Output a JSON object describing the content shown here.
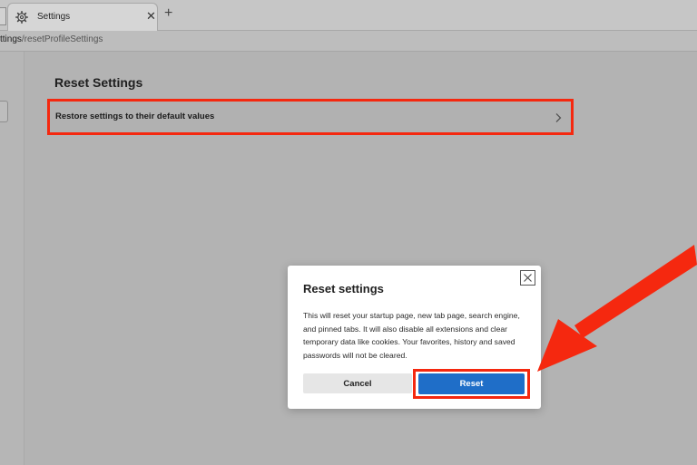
{
  "browser": {
    "tab": {
      "title": "Settings",
      "icon": "gear-icon",
      "close_icon": "close-icon"
    },
    "new_tab_icon": "plus-icon",
    "address": {
      "host_fragment": "ttings",
      "path": "/resetProfileSettings"
    }
  },
  "page": {
    "section_title": "Reset Settings",
    "restore_row": {
      "label": "Restore settings to their default values",
      "icon": "chevron-right-icon"
    }
  },
  "dialog": {
    "title": "Reset settings",
    "body": "This will reset your startup page, new tab page, search engine, and pinned tabs. It will also disable all extensions and clear temporary data like cookies. Your favorites, history and saved passwords will not be cleared.",
    "cancel_label": "Cancel",
    "reset_label": "Reset",
    "close_icon": "close-icon"
  },
  "annotations": {
    "highlight_color": "#f5280f",
    "arrow_color": "#f5280f"
  }
}
